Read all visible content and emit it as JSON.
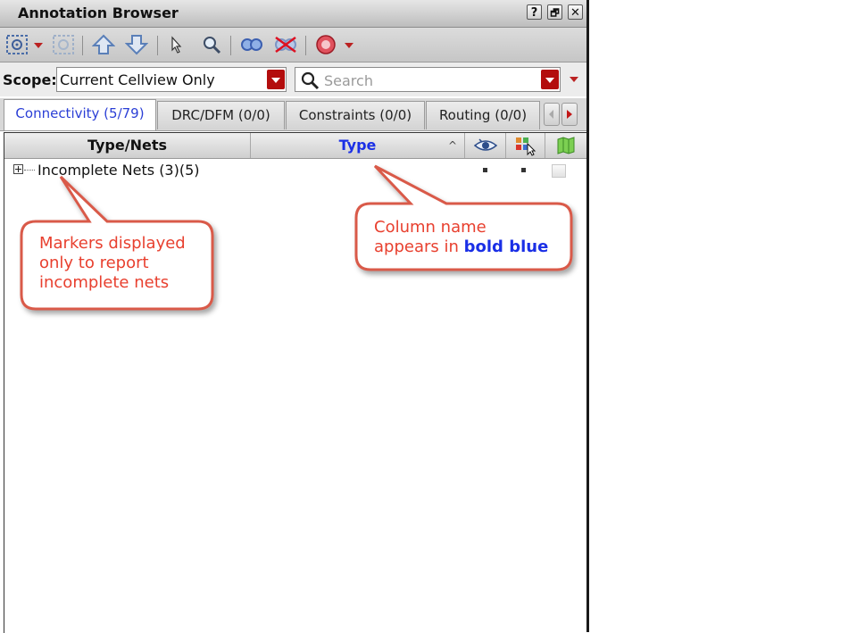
{
  "window": {
    "title": "Annotation Browser",
    "help_label": "?",
    "float_label": "🗗",
    "close_label": "✕"
  },
  "toolbar": {
    "icons": [
      "zoom-fit-icon",
      "zoom-selection-icon",
      "move-up-icon",
      "move-down-icon",
      "select-pointer-icon",
      "search-zoom-icon",
      "show-markers-icon",
      "hide-markers-icon",
      "stop-icon"
    ]
  },
  "scope": {
    "label": "Scope:",
    "value": "Current Cellview Only"
  },
  "search": {
    "placeholder": "Search"
  },
  "tabs": [
    {
      "label": "Connectivity (5/79)"
    },
    {
      "label": "DRC/DFM (0/0)"
    },
    {
      "label": "Constraints (0/0)"
    },
    {
      "label": "Routing (0/0)"
    }
  ],
  "tree": {
    "columns": [
      {
        "label": "Type/Nets"
      },
      {
        "label": "Type",
        "sort_indicator": "^"
      }
    ],
    "rows": [
      {
        "label": "Incomplete Nets (3)(5)"
      }
    ]
  },
  "callouts": {
    "left": {
      "line1": "Markers displayed",
      "line2": "only to report",
      "line3": "incomplete nets"
    },
    "right": {
      "line1": "Column name",
      "line2_prefix": "appears in ",
      "line2_bold": "bold blue"
    }
  },
  "colors": {
    "callout_text": "#e8402f",
    "callout_border": "#d95a4a",
    "bold_blue": "#1a2fe6",
    "dropdown_red": "#b30d0d"
  }
}
